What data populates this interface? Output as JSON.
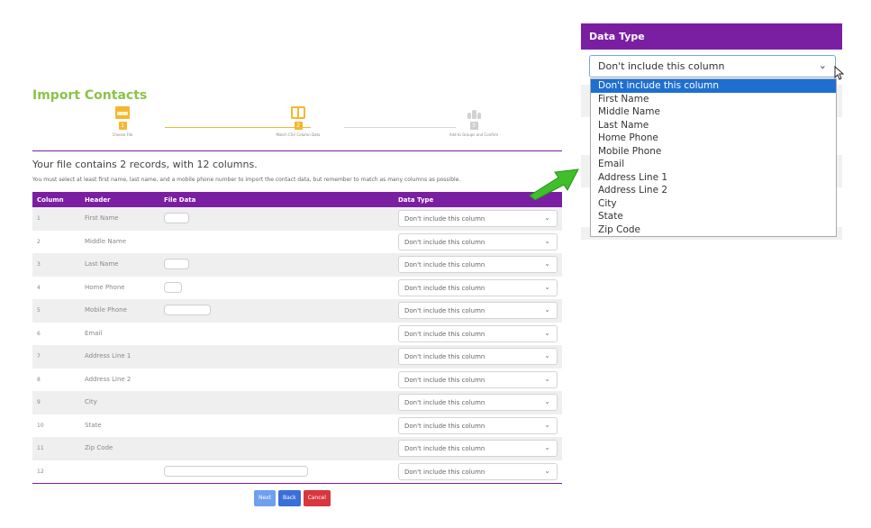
{
  "page": {
    "title": "Import Contacts"
  },
  "wizard": {
    "steps": [
      {
        "label": "Choose File",
        "marker": "1",
        "icon": "file-csv-icon"
      },
      {
        "label": "Match CSV Column Data",
        "marker": "2",
        "icon": "columns-icon"
      },
      {
        "label": "Add to Groups and Confirm",
        "marker": "3",
        "icon": "group-icon"
      }
    ]
  },
  "summary": "Your file contains 2 records, with 12 columns.",
  "notice": "You must select at least first name, last name, and a mobile phone number to import the contact data, but remember to match as many columns as possible.",
  "table": {
    "headers": {
      "column": "Column",
      "header": "Header",
      "file_data": "File Data",
      "data_type": "Data Type"
    },
    "rows": [
      {
        "column": "1",
        "header": "First Name",
        "data_type": "Don't include this column"
      },
      {
        "column": "2",
        "header": "Middle Name",
        "data_type": "Don't include this column"
      },
      {
        "column": "3",
        "header": "Last Name",
        "data_type": "Don't include this column"
      },
      {
        "column": "4",
        "header": "Home Phone",
        "data_type": "Don't include this column"
      },
      {
        "column": "5",
        "header": "Mobile Phone",
        "data_type": "Don't include this column"
      },
      {
        "column": "6",
        "header": "Email",
        "data_type": "Don't include this column"
      },
      {
        "column": "7",
        "header": "Address Line 1",
        "data_type": "Don't include this column"
      },
      {
        "column": "8",
        "header": "Address Line 2",
        "data_type": "Don't include this column"
      },
      {
        "column": "9",
        "header": "City",
        "data_type": "Don't include this column"
      },
      {
        "column": "10",
        "header": "State",
        "data_type": "Don't include this column"
      },
      {
        "column": "11",
        "header": "Zip Code",
        "data_type": "Don't include this column"
      },
      {
        "column": "12",
        "header": "",
        "data_type": "Don't include this column"
      }
    ]
  },
  "buttons": {
    "next": "Next",
    "back": "Back",
    "cancel": "Cancel"
  },
  "zoom": {
    "header": "Data Type",
    "selected": "Don't include this column",
    "options": [
      "Don't include this column",
      "First Name",
      "Middle Name",
      "Last Name",
      "Home Phone",
      "Mobile Phone",
      "Email",
      "Address Line 1",
      "Address Line 2",
      "City",
      "State",
      "Zip Code"
    ],
    "highlighted_index": 0
  },
  "colors": {
    "accent_purple": "#7b1fa2",
    "title_green": "#8bc34a",
    "step_orange": "#f5b731",
    "next_blue": "#6fa0ef",
    "back_blue": "#3b6fd8",
    "cancel_red": "#d9363e",
    "highlight_blue": "#1f6fd1"
  }
}
